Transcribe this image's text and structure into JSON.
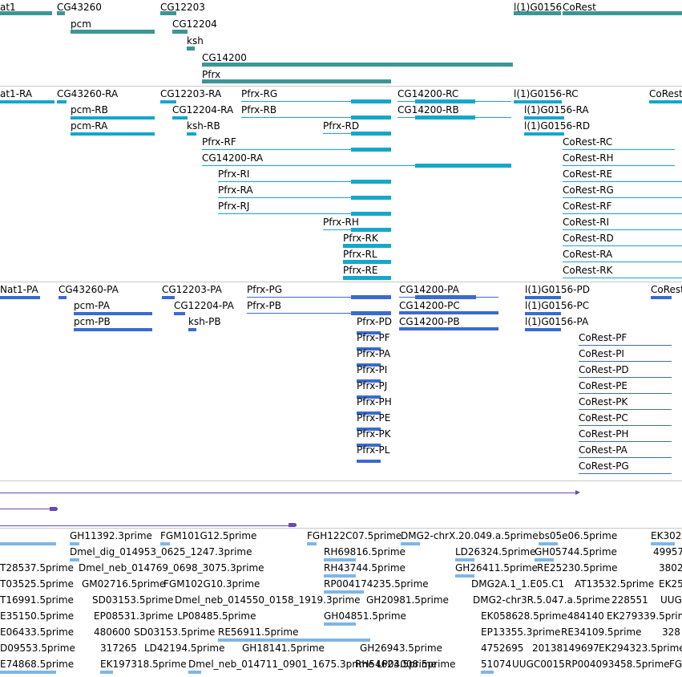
{
  "colors": {
    "gene": "#3c9696",
    "transcript": "#17a6cc",
    "protein": "#3a6ad2",
    "alignment": "#6a48b0",
    "est": "#7fb6e6",
    "separator": "#c8c8c8"
  },
  "tracks": {
    "genes": {
      "labels": [
        "at1",
        "CG43260",
        "CG12203",
        "l(1)G0156",
        "CoRest",
        "pcm",
        "CG12204",
        "ksh",
        "CG14200",
        "Pfrx"
      ]
    },
    "transcripts": {
      "labels": [
        "at1-RA",
        "CG43260-RA",
        "CG12203-RA",
        "Pfrx-RG",
        "CG14200-RC",
        "l(1)G0156-RC",
        "CoRest",
        "pcm-RB",
        "CG12204-RA",
        "Pfrx-RB",
        "CG14200-RB",
        "l(1)G0156-RA",
        "pcm-RA",
        "ksh-RB",
        "Pfrx-RD",
        "l(1)G0156-RD",
        "Pfrx-RF",
        "CoRest-RC",
        "CG14200-RA",
        "CoRest-RH",
        "Pfrx-RI",
        "CoRest-RE",
        "Pfrx-RA",
        "CoRest-RG",
        "Pfrx-RJ",
        "CoRest-RF",
        "Pfrx-RH",
        "CoRest-RI",
        "Pfrx-RK",
        "CoRest-RD",
        "Pfrx-RL",
        "CoRest-RA",
        "Pfrx-RE",
        "CoRest-RK"
      ]
    },
    "proteins": {
      "labels": [
        "Nat1-PA",
        "CG43260-PA",
        "CG12203-PA",
        "Pfrx-PG",
        "CG14200-PA",
        "l(1)G0156-PD",
        "CoRest",
        "pcm-PA",
        "CG12204-PA",
        "Pfrx-PB",
        "CG14200-PC",
        "l(1)G0156-PC",
        "pcm-PB",
        "ksh-PB",
        "Pfrx-PD",
        "CG14200-PB",
        "l(1)G0156-PA",
        "Pfrx-PF",
        "CoRest-PF",
        "Pfrx-PA",
        "CoRest-PI",
        "Pfrx-PI",
        "CoRest-PD",
        "Pfrx-PJ",
        "CoRest-PE",
        "Pfrx-PH",
        "CoRest-PK",
        "Pfrx-PE",
        "CoRest-PC",
        "Pfrx-PK",
        "CoRest-PH",
        "Pfrx-PL",
        "CoRest-PA",
        "CoRest-PG"
      ]
    },
    "ests": {
      "labels": [
        "GH11392.3prime",
        "FGM101G12.5prime",
        "FGH122C07.5prime",
        "DMG2-chrX.20.049.a.5prime",
        "bs05e06.5prime",
        "EK302",
        "Dmel_dig_014953_0625_1247.3prime",
        "RH69816.5prime",
        "LD26324.5prime",
        "GH05744.5prime",
        "49957",
        "T28537.5prime",
        "Dmel_neb_014769_0698_3075.3prime",
        "RH43744.5prime",
        "GH26411.5prime",
        "RE25230.5prime",
        "3802",
        "T03525.5prime",
        "GM02716.5prime",
        "FGM102G10.3prime",
        "RP004174235.5prime",
        "DMG2A.1_1.E05.C1",
        "AT13532.5prime",
        "EK25",
        "T16991.5prime",
        "SD03153.5prime",
        "Dmel_neb_014550_0158_1919.3prime",
        "GH20981.5prime",
        "DMG2-chr3R.5.047.a.5prime",
        "228551",
        "UUG",
        "E35150.5prime",
        "EP08531.3prime",
        "LP08485.5prime",
        "GH04851.5prime",
        "EK058628.5prime",
        "484140",
        "EK279339.5prime",
        "E06433.5prime",
        "480600",
        "SD03153.5prime",
        "RE56911.5prime",
        "EP13355.3prime",
        "RE34109.5prime",
        "328",
        "D09553.5prime",
        "317265",
        "LD42194.5prime",
        "GH18141.5prime",
        "GH26943.5prime",
        "RH54623.5prime",
        "4752695",
        "20138",
        "149697",
        "EK294323.5prime",
        "E74868.5prime",
        "EK197318.5prime",
        "Dmel_neb_014711_0901_1675.3prime",
        "LP04008.5prime",
        "51074",
        "UUGC0015",
        "RP004093458.5prime",
        "FG"
      ]
    }
  }
}
